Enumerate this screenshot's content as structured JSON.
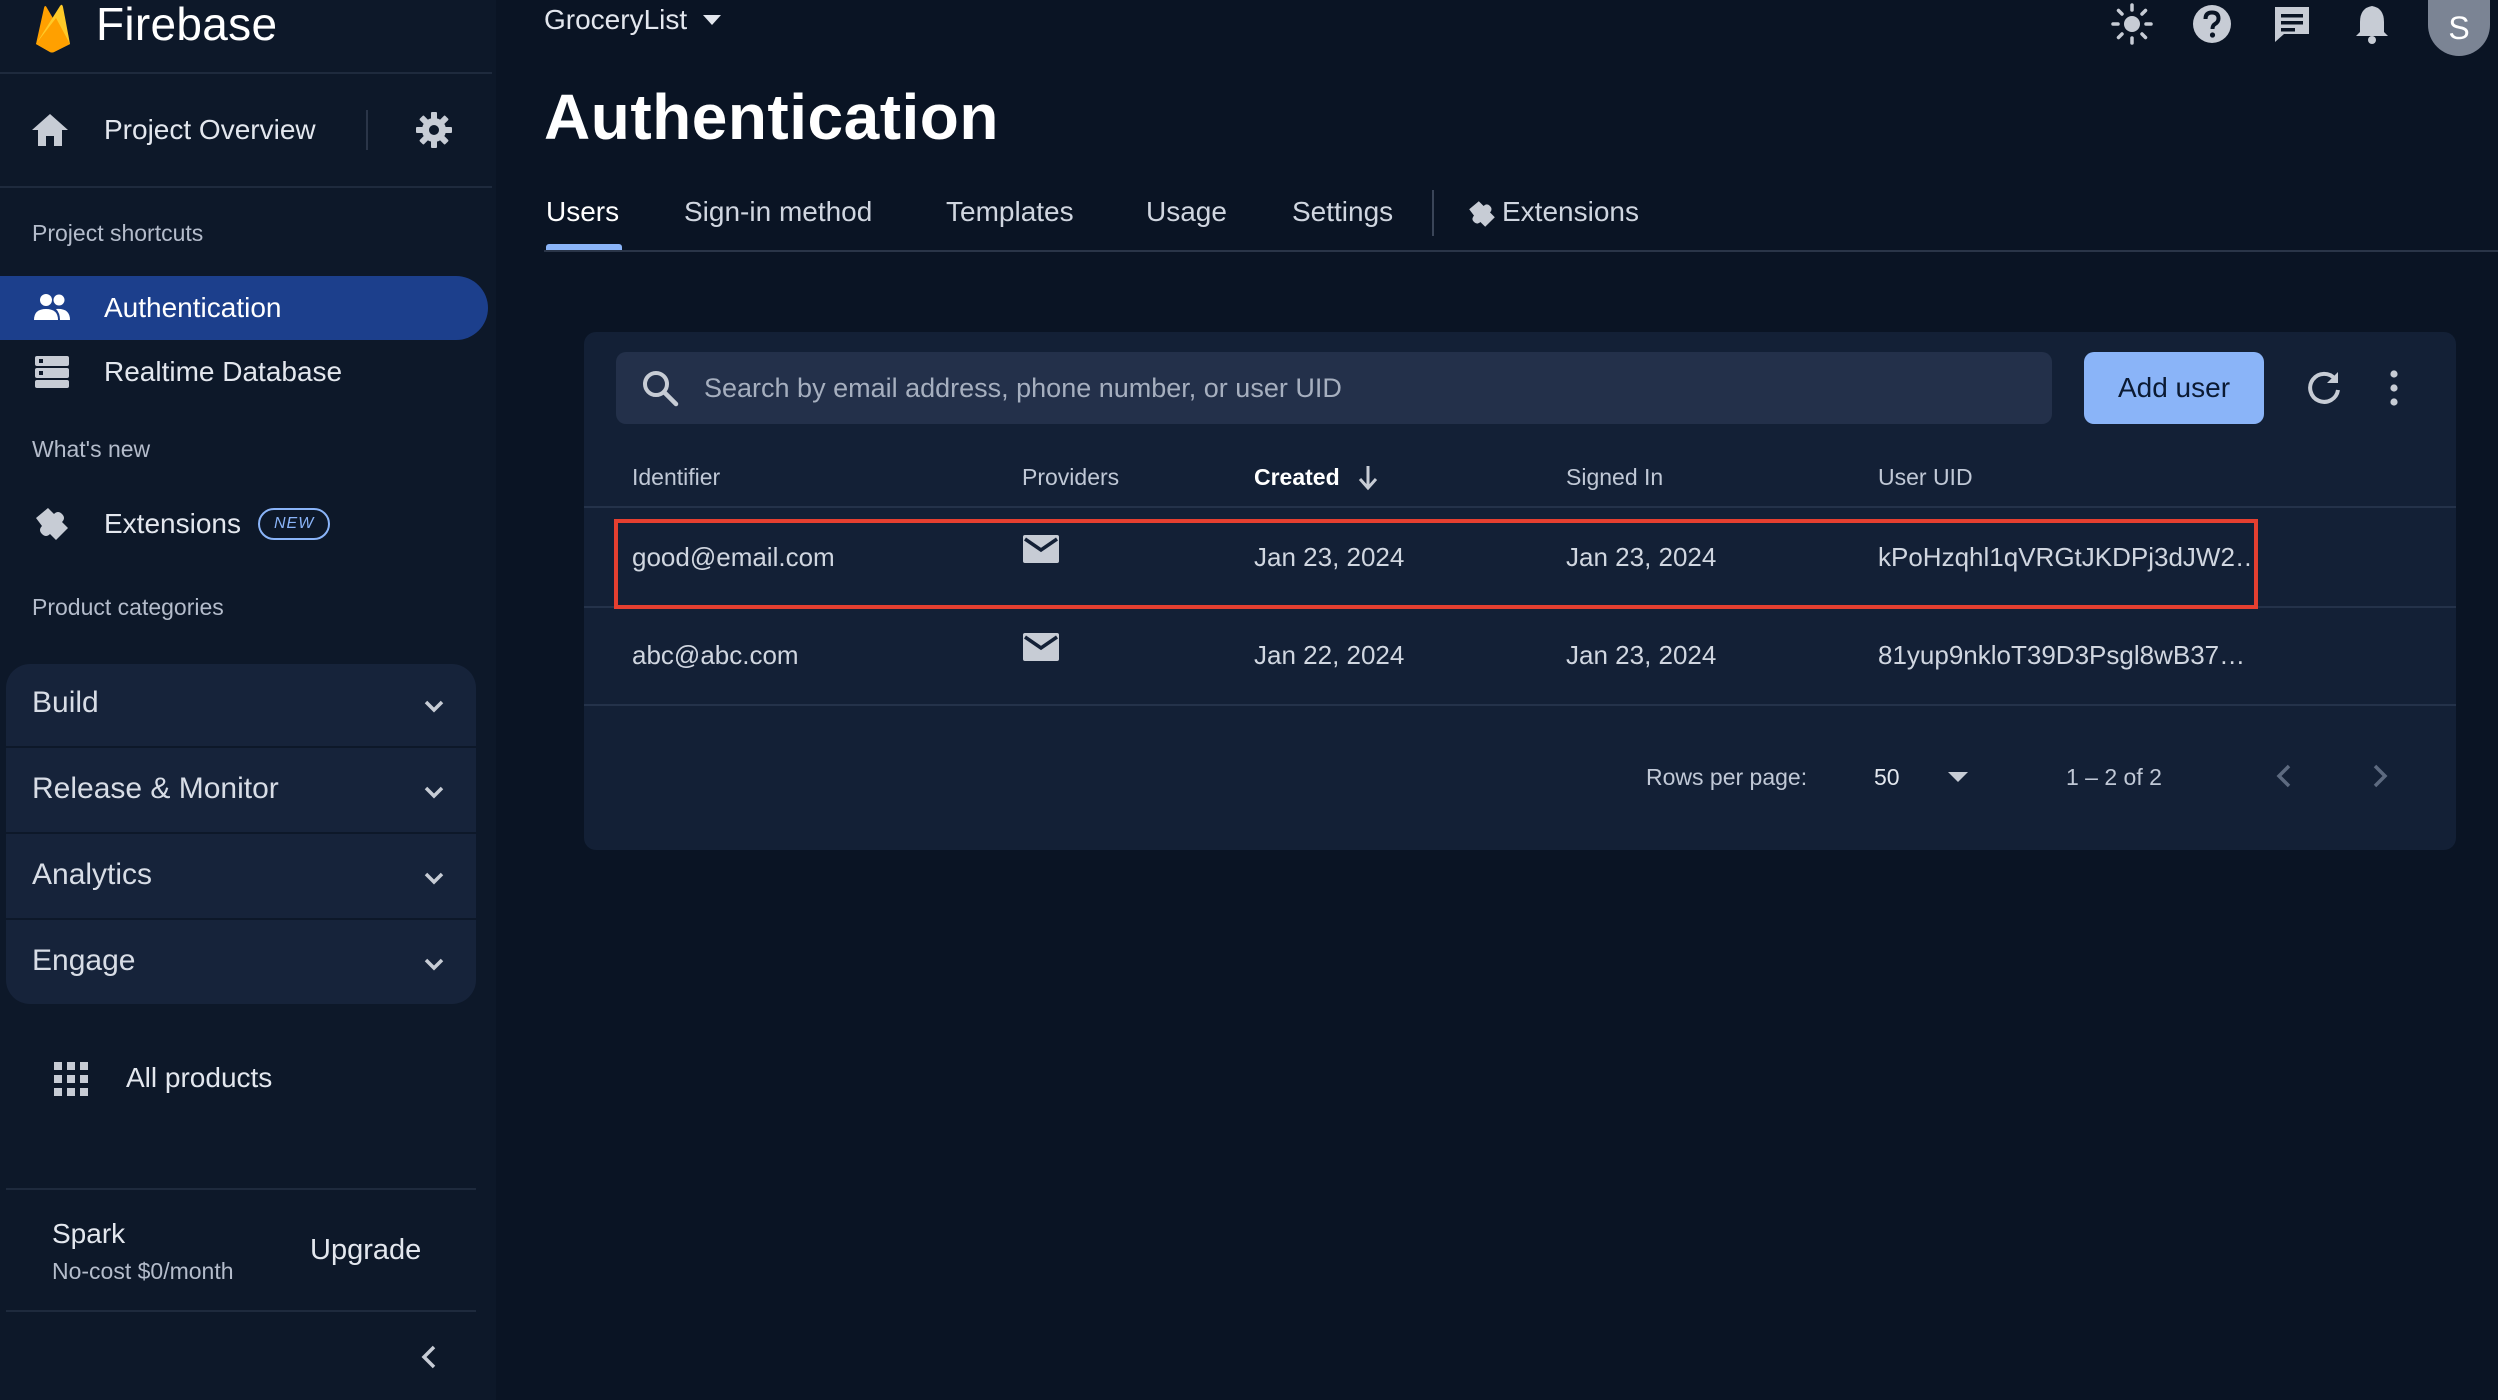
{
  "brand": {
    "name": "Firebase"
  },
  "sidebar": {
    "overview_label": "Project Overview",
    "shortcuts_heading": "Project shortcuts",
    "shortcuts": [
      {
        "label": "Authentication",
        "icon": "people-icon",
        "active": true
      },
      {
        "label": "Realtime Database",
        "icon": "database-icon",
        "active": false
      }
    ],
    "whats_new_heading": "What's new",
    "extensions": {
      "label": "Extensions",
      "badge": "NEW"
    },
    "categories_heading": "Product categories",
    "categories": [
      {
        "label": "Build"
      },
      {
        "label": "Release & Monitor"
      },
      {
        "label": "Analytics"
      },
      {
        "label": "Engage"
      }
    ],
    "all_products_label": "All products",
    "plan": {
      "name": "Spark",
      "description": "No-cost $0/month",
      "upgrade_label": "Upgrade"
    }
  },
  "header": {
    "project_name": "GroceryList",
    "icons": [
      "theme-icon",
      "help-icon",
      "feedback-icon",
      "notifications-icon"
    ],
    "avatar_initial": "S"
  },
  "page": {
    "title": "Authentication",
    "tabs": [
      {
        "label": "Users",
        "active": true
      },
      {
        "label": "Sign-in method",
        "active": false
      },
      {
        "label": "Templates",
        "active": false
      },
      {
        "label": "Usage",
        "active": false
      },
      {
        "label": "Settings",
        "active": false
      },
      {
        "label": "Extensions",
        "active": false
      }
    ]
  },
  "users": {
    "search_placeholder": "Search by email address, phone number, or user UID",
    "add_user_label": "Add user",
    "columns": [
      "Identifier",
      "Providers",
      "Created",
      "Signed In",
      "User UID"
    ],
    "sorted_column": "Created",
    "rows": [
      {
        "identifier": "good@email.com",
        "provider": "email",
        "created": "Jan 23, 2024",
        "signed_in": "Jan 23, 2024",
        "uid": "kPoHzqhl1qVRGtJKDPj3dJW2…",
        "highlighted": true
      },
      {
        "identifier": "abc@abc.com",
        "provider": "email",
        "created": "Jan 22, 2024",
        "signed_in": "Jan 23, 2024",
        "uid": "81yup9nkloT39D3Psgl8wB37…",
        "highlighted": false
      }
    ],
    "pagination": {
      "rows_per_page_label": "Rows per page:",
      "rows_per_page": "50",
      "range": "1 – 2 of 2"
    }
  },
  "colors": {
    "background": "#0a1424",
    "sidebar": "#0d1829",
    "card": "#132036",
    "accent": "#8ab4f8",
    "active_nav": "#1c3f8c",
    "highlight_border": "#e53f30",
    "firebase_orange": "#ffa000",
    "firebase_yellow": "#ffca28"
  }
}
